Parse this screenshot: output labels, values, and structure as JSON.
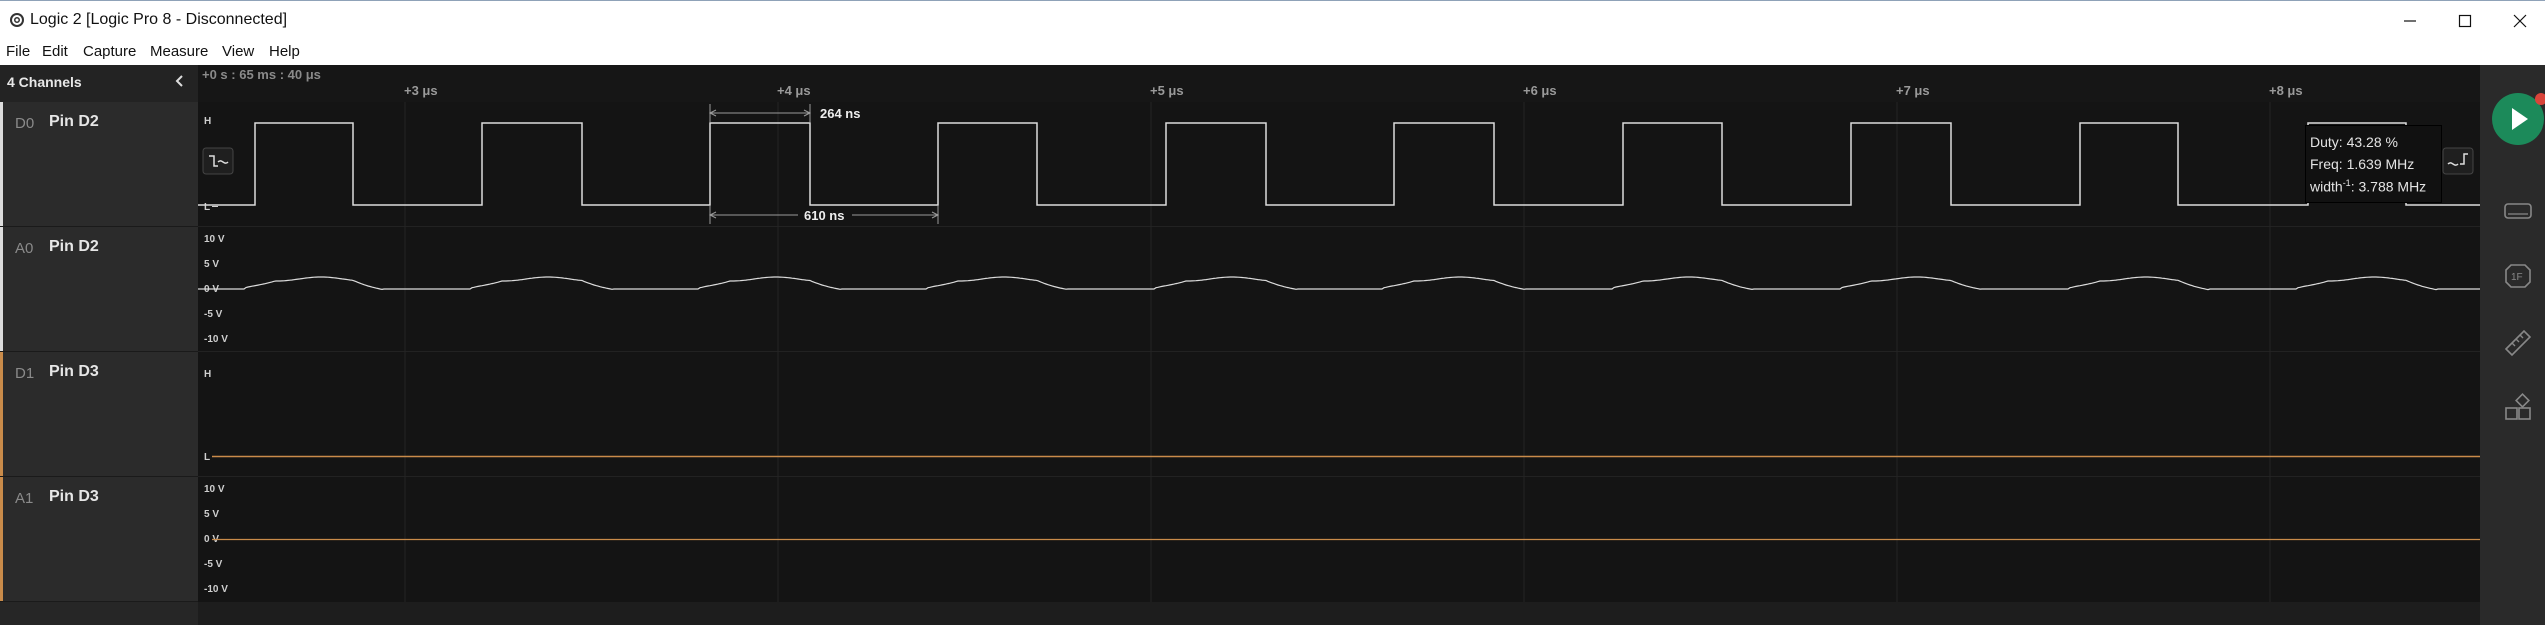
{
  "window": {
    "title": "Logic 2 [Logic Pro 8 - Disconnected]"
  },
  "menu": [
    "File",
    "Edit",
    "Capture",
    "Measure",
    "View",
    "Help"
  ],
  "sidebar": {
    "header": "4 Channels",
    "channels": [
      {
        "id": "D0",
        "name": "Pin D2"
      },
      {
        "id": "A0",
        "name": "Pin D2"
      },
      {
        "id": "D1",
        "name": "Pin D3"
      },
      {
        "id": "A1",
        "name": "Pin D3"
      }
    ]
  },
  "timeline": {
    "origin": "+0 s : 65 ms : 40 μs",
    "ticks": [
      "+3 μs",
      "+4 μs",
      "+5 μs",
      "+6 μs",
      "+7 μs",
      "+8 μs"
    ]
  },
  "digital_labels": {
    "high": "H",
    "low": "L"
  },
  "analog_labels": [
    "10 V",
    "5 V",
    "0 V",
    "-5 V",
    "-10 V"
  ],
  "measurements": {
    "pulse_width": "264 ns",
    "period": "610 ns"
  },
  "tooltip": {
    "duty": "Duty: 43.28 %",
    "freq": "Freq: 1.639 MHz",
    "width_prefix": "width",
    "width_exp": "-1",
    "width_value": ": 3.788 MHz"
  },
  "colors": {
    "digital_d0": "#dcdcdc",
    "channel_d1": "#c98b4a",
    "play": "#1c8a5a",
    "record": "#d9443a"
  },
  "icons": {
    "app": "logic-logo-icon",
    "minimize": "minimize-icon",
    "maximize": "maximize-icon",
    "close": "close-icon",
    "collapse": "chevron-left-icon",
    "falling_edge": "falling-edge-icon",
    "rising_edge": "rising-edge-icon",
    "rail": [
      "device-icon",
      "analyzer-icon",
      "measure-ruler-icon",
      "extensions-icon"
    ]
  }
}
